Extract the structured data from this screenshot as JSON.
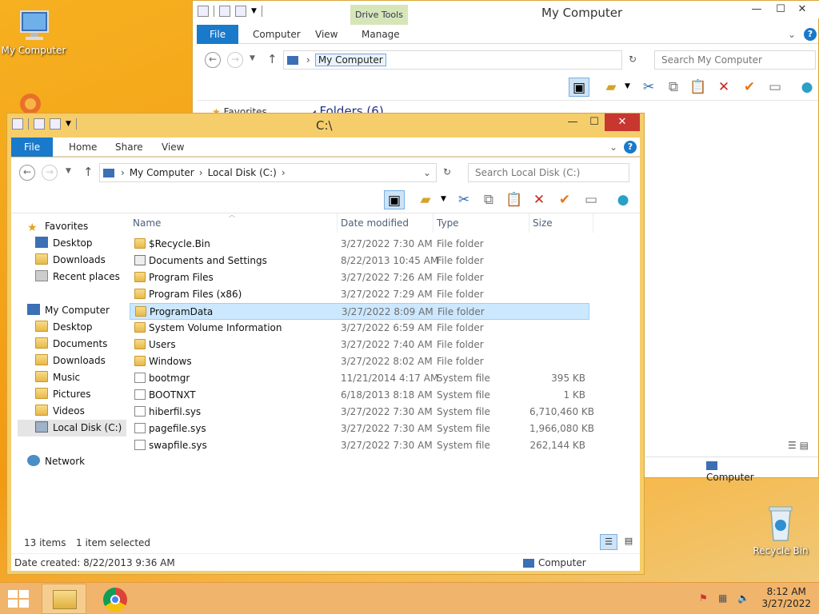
{
  "desktop": {
    "icons": [
      {
        "label": "My Computer"
      },
      {
        "label": "Recycle Bin"
      }
    ]
  },
  "back_window": {
    "title": "My Computer",
    "context_tab_group": "Drive Tools",
    "tabs": [
      {
        "label": "File"
      },
      {
        "label": "Computer"
      },
      {
        "label": "View"
      },
      {
        "label": "Manage"
      }
    ],
    "address": "My Computer",
    "search_placeholder": "Search My Computer",
    "partial_favorites": "Favorites",
    "partial_folders": "Folders (6)",
    "status_location": "Computer"
  },
  "front_window": {
    "title": "C:\\",
    "tabs": [
      {
        "label": "File"
      },
      {
        "label": "Home"
      },
      {
        "label": "Share"
      },
      {
        "label": "View"
      }
    ],
    "breadcrumb": [
      "My Computer",
      "Local Disk (C:)"
    ],
    "search_placeholder": "Search Local Disk (C:)",
    "nav": {
      "favorites_header": "Favorites",
      "favorites": [
        {
          "label": "Desktop"
        },
        {
          "label": "Downloads"
        },
        {
          "label": "Recent places"
        }
      ],
      "computer_header": "My Computer",
      "computer": [
        {
          "label": "Desktop"
        },
        {
          "label": "Documents"
        },
        {
          "label": "Downloads"
        },
        {
          "label": "Music"
        },
        {
          "label": "Pictures"
        },
        {
          "label": "Videos"
        },
        {
          "label": "Local Disk (C:)"
        }
      ],
      "network": "Network"
    },
    "columns": {
      "name": "Name",
      "date": "Date modified",
      "type": "Type",
      "size": "Size"
    },
    "files": [
      {
        "name": "$Recycle.Bin",
        "date": "3/27/2022 7:30 AM",
        "type": "File folder",
        "size": "",
        "kind": "folder"
      },
      {
        "name": "Documents and Settings",
        "date": "8/22/2013 10:45 AM",
        "type": "File folder",
        "size": "",
        "kind": "shortcut"
      },
      {
        "name": "Program Files",
        "date": "3/27/2022 7:26 AM",
        "type": "File folder",
        "size": "",
        "kind": "folder"
      },
      {
        "name": "Program Files (x86)",
        "date": "3/27/2022 7:29 AM",
        "type": "File folder",
        "size": "",
        "kind": "folder"
      },
      {
        "name": "ProgramData",
        "date": "3/27/2022 8:09 AM",
        "type": "File folder",
        "size": "",
        "kind": "folder",
        "selected": true
      },
      {
        "name": "System Volume Information",
        "date": "3/27/2022 6:59 AM",
        "type": "File folder",
        "size": "",
        "kind": "folder"
      },
      {
        "name": "Users",
        "date": "3/27/2022 7:40 AM",
        "type": "File folder",
        "size": "",
        "kind": "folder"
      },
      {
        "name": "Windows",
        "date": "3/27/2022 8:02 AM",
        "type": "File folder",
        "size": "",
        "kind": "folder"
      },
      {
        "name": "bootmgr",
        "date": "11/21/2014 4:17 AM",
        "type": "System file",
        "size": "395 KB",
        "kind": "sys"
      },
      {
        "name": "BOOTNXT",
        "date": "6/18/2013 8:18 AM",
        "type": "System file",
        "size": "1 KB",
        "kind": "sys"
      },
      {
        "name": "hiberfil.sys",
        "date": "3/27/2022 7:30 AM",
        "type": "System file",
        "size": "6,710,460 KB",
        "kind": "sys"
      },
      {
        "name": "pagefile.sys",
        "date": "3/27/2022 7:30 AM",
        "type": "System file",
        "size": "1,966,080 KB",
        "kind": "sys"
      },
      {
        "name": "swapfile.sys",
        "date": "3/27/2022 7:30 AM",
        "type": "System file",
        "size": "262,144 KB",
        "kind": "sys"
      }
    ],
    "status": {
      "items": "13 items",
      "selected": "1 item selected",
      "details": "Date created: 8/22/2013 9:36 AM",
      "location": "Computer"
    }
  },
  "taskbar": {
    "time": "8:12 AM",
    "date": "3/27/2022"
  },
  "colors": {
    "accent": "#1979ca",
    "selection": "#cce8ff",
    "close": "#c7372f",
    "window_frame": "#f5cd6a"
  }
}
